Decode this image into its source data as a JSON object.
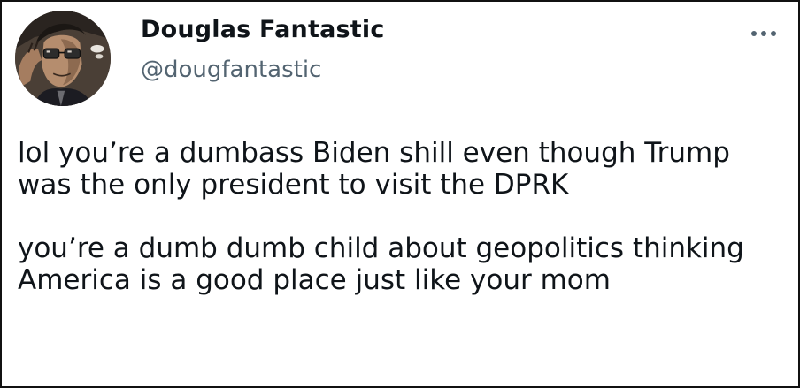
{
  "tweet": {
    "author": {
      "display_name": "Douglas Fantastic",
      "handle": "@dougfantastic",
      "avatar_icon": "comic-character-avatar"
    },
    "menu_icon": "more-horizontal-icon",
    "text": {
      "paragraph_1": "lol you’re a dumbass Biden shill even though Trump was the only president to visit the DPRK",
      "paragraph_2": "you’re a dumb dumb child about geopolitics thinking America is a good place just like your mom"
    }
  },
  "colors": {
    "text_primary": "#0f1419",
    "text_secondary": "#536471",
    "border": "#111111",
    "background": "#ffffff"
  }
}
